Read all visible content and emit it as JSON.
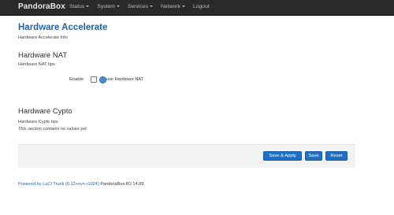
{
  "navbar": {
    "brand": "PandoraBox",
    "items": [
      "Status",
      "System",
      "Services",
      "Network",
      "Logout"
    ]
  },
  "page": {
    "title": "Hardware Accelerate",
    "description": "Hardware Accelerate Info"
  },
  "hardware_nat": {
    "title": "Hardware NAT",
    "description": "Hardware NAT tips",
    "field_label": "Enable",
    "checkbox_checked": false,
    "help_text": "use Hardware NAT"
  },
  "hardware_crypto": {
    "title": "Hardware Cypto",
    "description": "Hardware Cypto tips",
    "note": "This section contains no values yet"
  },
  "actions": {
    "save_apply": "Save & Apply",
    "save": "Save",
    "reset": "Reset"
  },
  "footer": {
    "link_text": "Powered by LuCI Trunk (0.12+svn-r1024)",
    "version_text": "PandoraBox R2 14.09"
  },
  "colors": {
    "navbar_bg": "#2a2a2a",
    "title_blue": "#1f66a8",
    "button_blue": "#1f6fc4"
  }
}
